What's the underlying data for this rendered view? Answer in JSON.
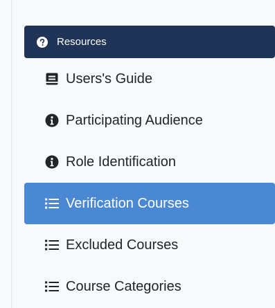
{
  "resources": {
    "header": {
      "label": "Resources",
      "icon": "question-circle-icon"
    },
    "items": [
      {
        "label": "Users's Guide",
        "icon": "book-icon",
        "active": false
      },
      {
        "label": "Participating Audience",
        "icon": "info-circle-icon",
        "active": false
      },
      {
        "label": "Role Identification",
        "icon": "info-circle-icon",
        "active": false
      },
      {
        "label": "Verification Courses",
        "icon": "list-icon",
        "active": true
      },
      {
        "label": "Excluded Courses",
        "icon": "list-icon",
        "active": false
      },
      {
        "label": "Course Categories",
        "icon": "list-icon",
        "active": false
      }
    ]
  },
  "colors": {
    "header_bg": "#1f3456",
    "active_bg": "#4a88d3",
    "text": "#212529",
    "page_bg": "#f8f9fa"
  }
}
